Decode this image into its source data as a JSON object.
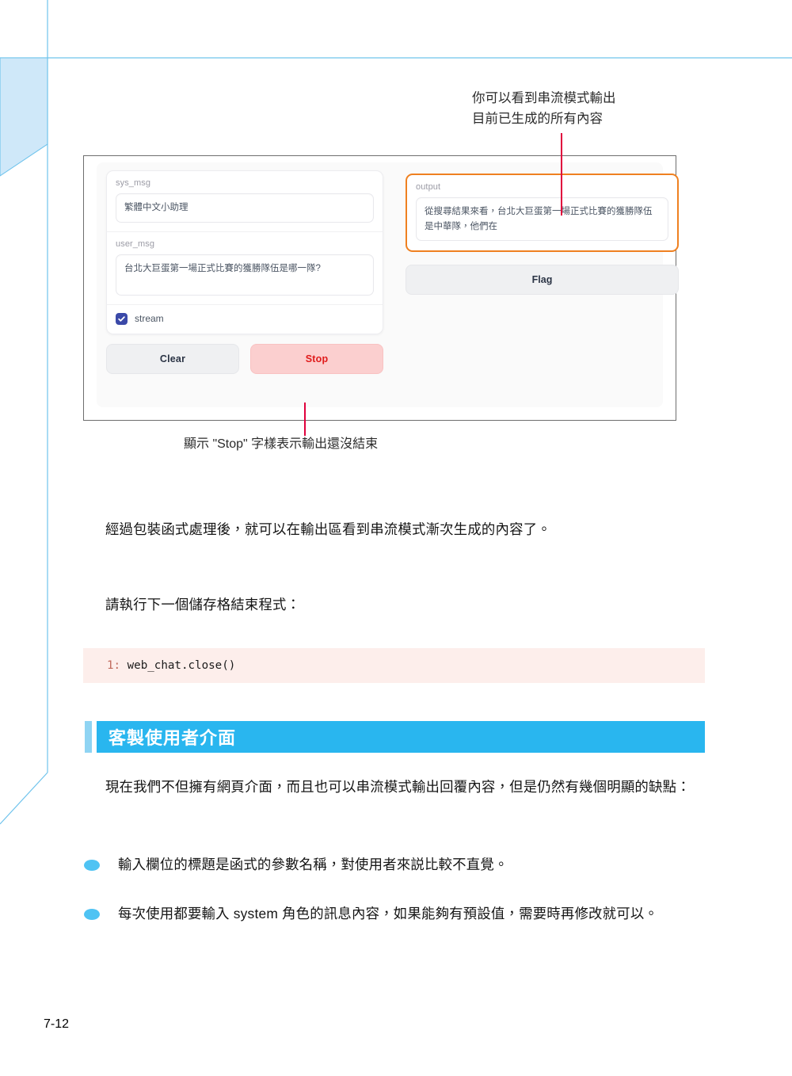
{
  "page": {
    "folio": "7-12"
  },
  "decoration": {
    "rule_color": "#6fc3ec",
    "shape_fill": "#cfe8f9",
    "shape_stroke": "#6fc3ec"
  },
  "figure": {
    "app": {
      "sys_msg": {
        "label": "sys_msg",
        "value": "繁體中文小助理"
      },
      "user_msg": {
        "label": "user_msg",
        "value": "台北大巨蛋第一場正式比賽的獲勝隊伍是哪一隊?"
      },
      "stream_checkbox": {
        "label": "stream",
        "checked": true,
        "color": "#3b49a8"
      },
      "clear_button": "Clear",
      "stop_button": "Stop",
      "output": {
        "label": "output",
        "value": "從搜尋結果來看，台北大巨蛋第一場正式比賽的獲勝隊伍是中華隊，他們在",
        "highlight_color": "#ef8020"
      },
      "flag_button": "Flag"
    },
    "annotations": {
      "top": "你可以看到串流模式輸出\n目前已生成的所有內容",
      "bottom": "顯示 \"Stop\" 字樣表示輸出還沒結束",
      "leader_color": "#e0003c"
    }
  },
  "body": {
    "paragraph_1": "經過包裝函式處理後，就可以在輸出區看到串流模式漸次生成的內容了。",
    "paragraph_2": "請執行下一個儲存格結束程式：",
    "code": {
      "line_number": "1:",
      "text": "web_chat.close()"
    },
    "heading": {
      "text": "客製使用者介面",
      "bar_color": "#29b6ef",
      "accent_color": "#8fd4f3"
    },
    "paragraph_3": "現在我們不但擁有網頁介面，而且也可以串流模式輸出回覆內容，但是仍然有幾個明顯的缺點：",
    "bullets": [
      "輸入欄位的標題是函式的參數名稱，對使用者來説比較不直覺。",
      "每次使用都要輸入 system 角色的訊息內容，如果能夠有預設值，需要時再修改就可以。"
    ],
    "bullet_color": "#4fc3f3"
  }
}
